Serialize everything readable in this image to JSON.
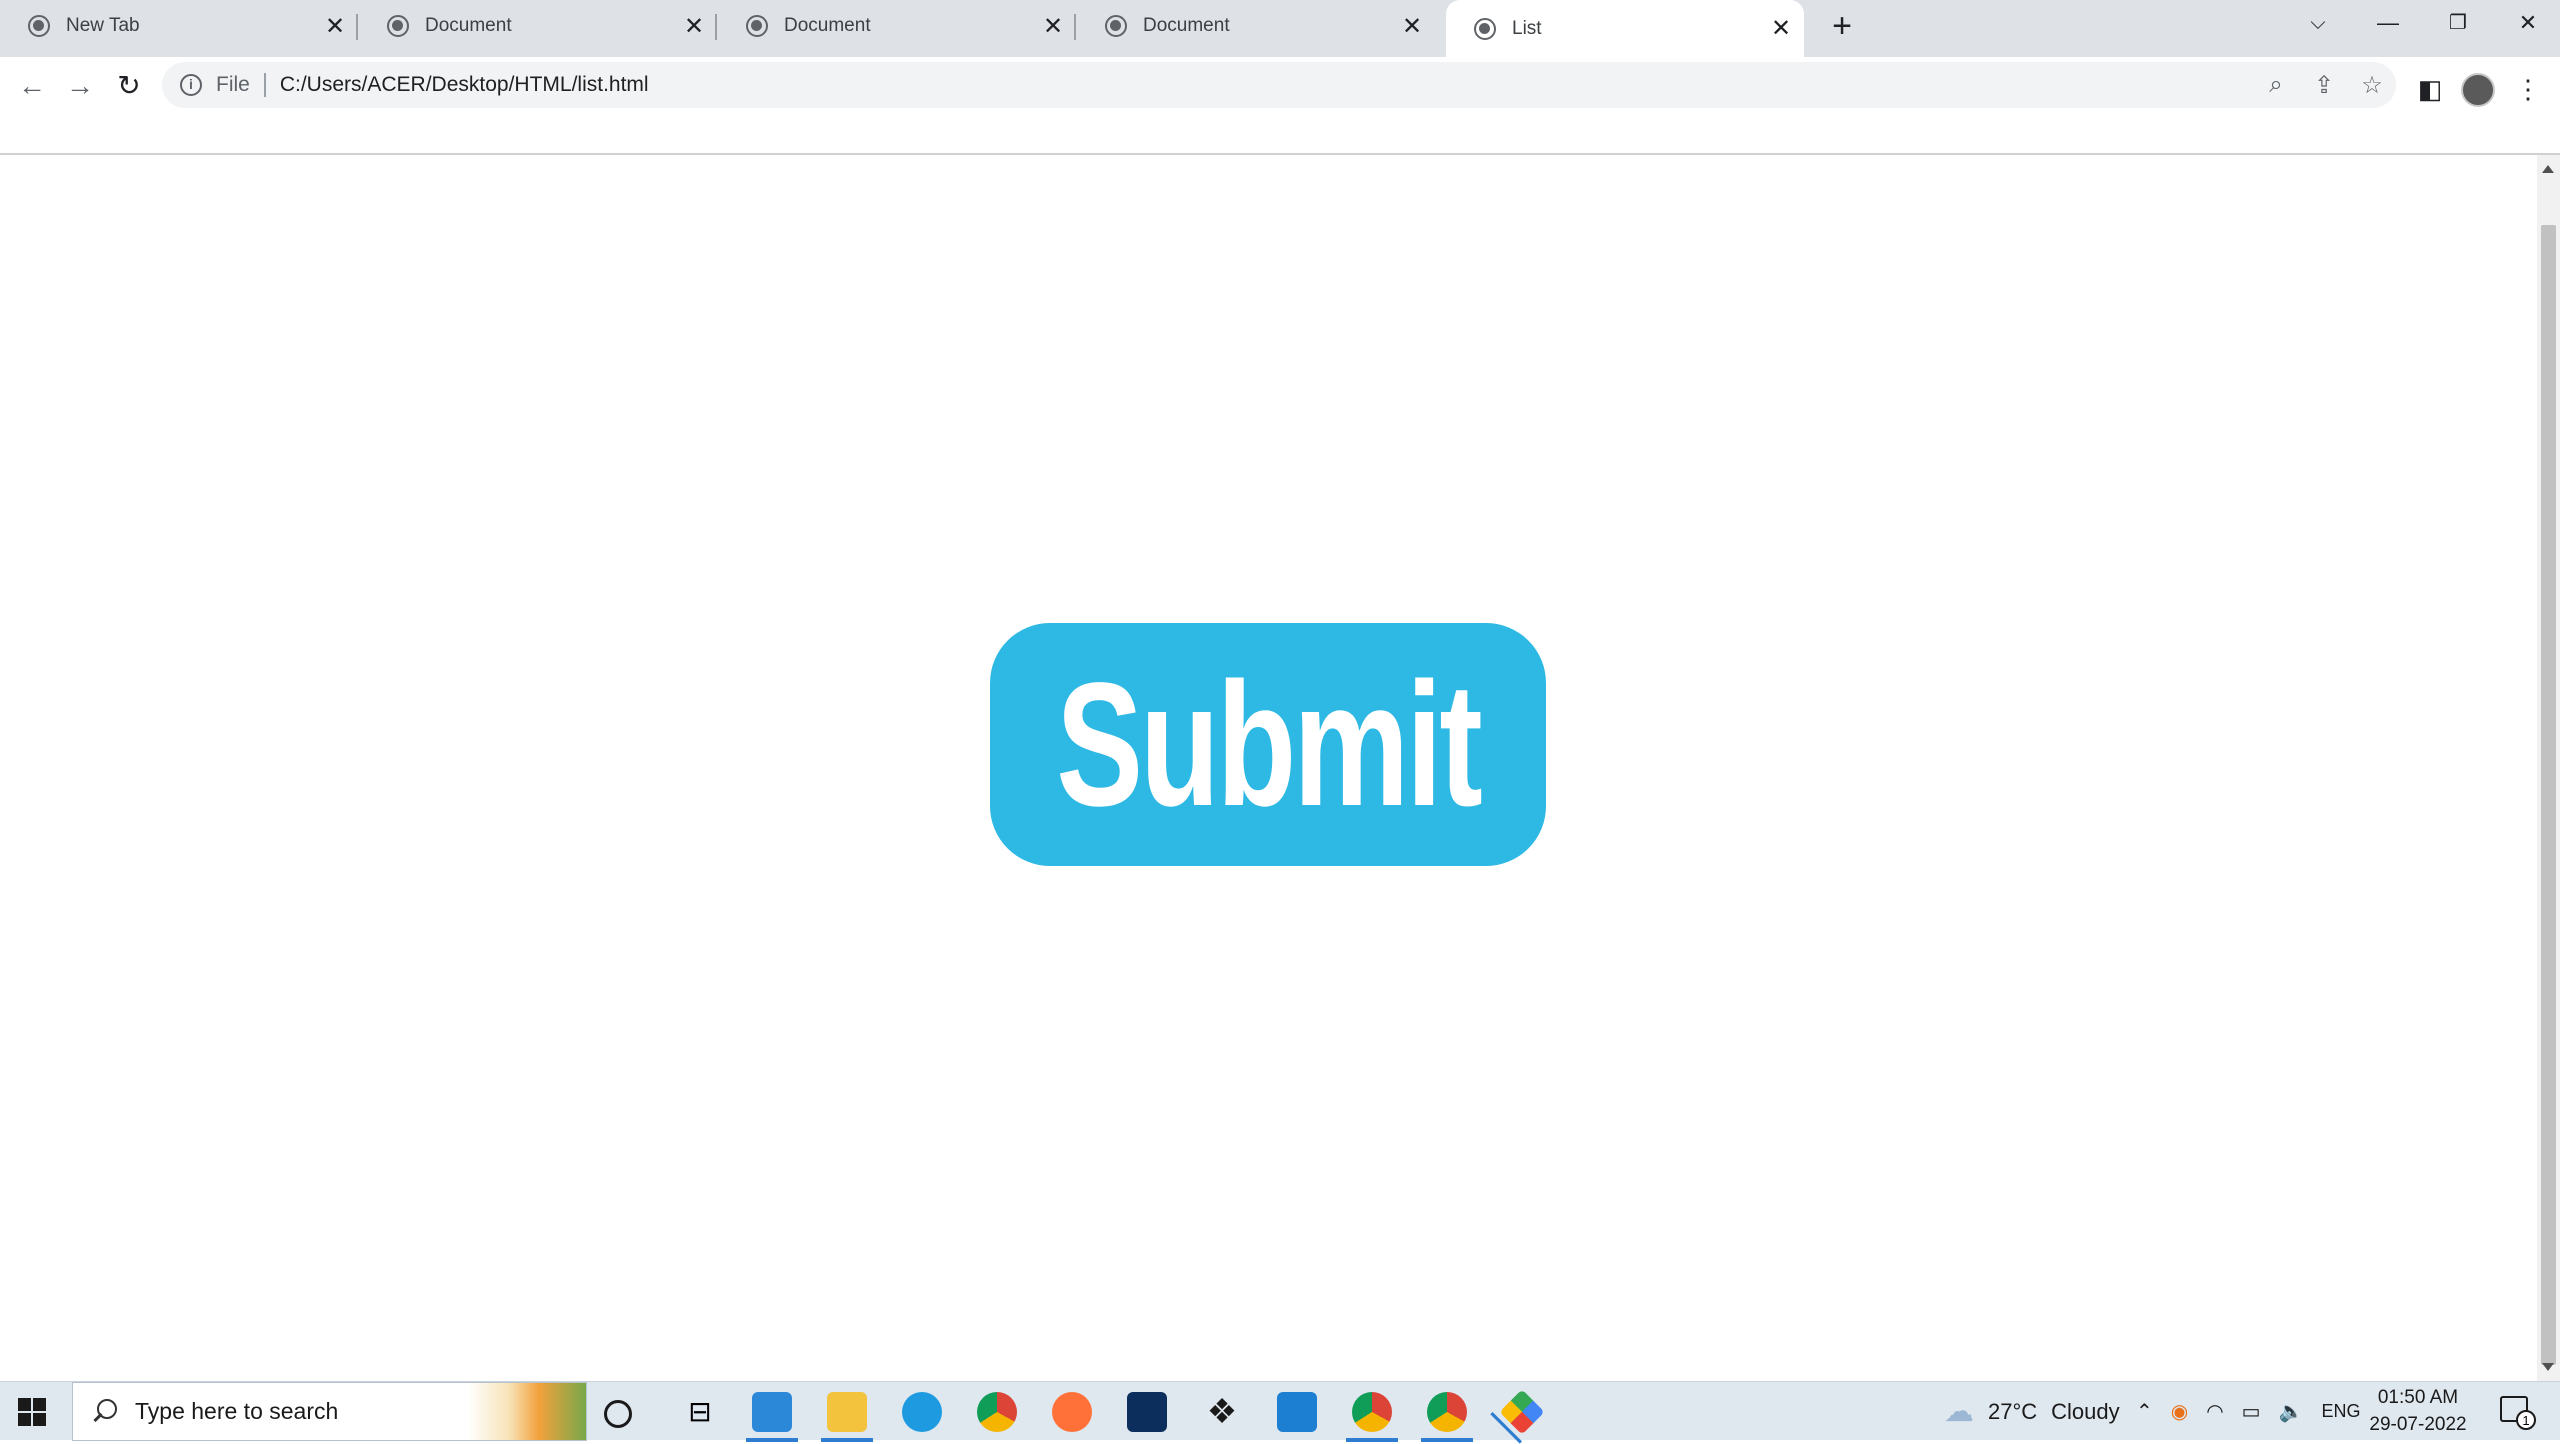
{
  "browser": {
    "tabs": [
      {
        "title": "New Tab",
        "active": false
      },
      {
        "title": "Document",
        "active": false
      },
      {
        "title": "Document",
        "active": false
      },
      {
        "title": "Document",
        "active": false
      },
      {
        "title": "List",
        "active": true
      }
    ],
    "address": {
      "scheme_label": "File",
      "url": "C:/Users/ACER/Desktop/HTML/list.html"
    }
  },
  "page": {
    "submit_label": "Submit",
    "button_color": "#2eb9e5"
  },
  "taskbar": {
    "search_placeholder": "Type here to search",
    "weather_temp": "27°C",
    "weather_desc": "Cloudy",
    "language": "ENG",
    "time": "01:50 AM",
    "date": "29-07-2022",
    "notification_count": "1"
  }
}
